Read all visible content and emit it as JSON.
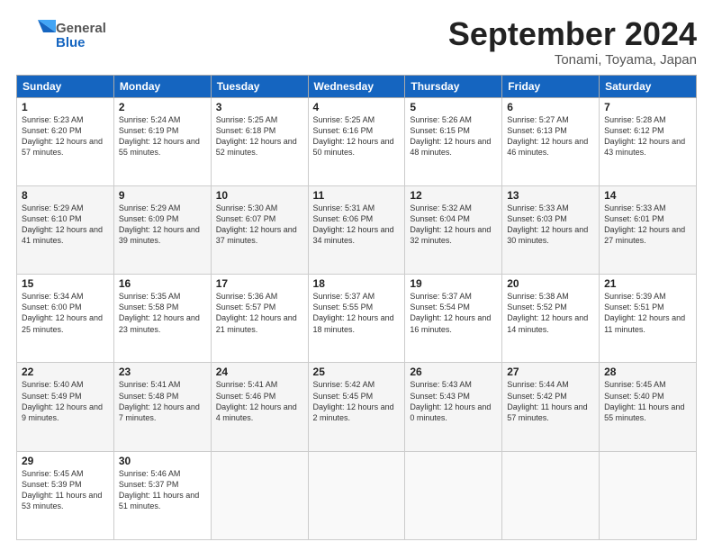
{
  "header": {
    "logo_general": "General",
    "logo_blue": "Blue",
    "month": "September 2024",
    "location": "Tonami, Toyama, Japan"
  },
  "days_of_week": [
    "Sunday",
    "Monday",
    "Tuesday",
    "Wednesday",
    "Thursday",
    "Friday",
    "Saturday"
  ],
  "weeks": [
    [
      {
        "day": "1",
        "sunrise": "5:23 AM",
        "sunset": "6:20 PM",
        "daylight": "12 hours and 57 minutes."
      },
      {
        "day": "2",
        "sunrise": "5:24 AM",
        "sunset": "6:19 PM",
        "daylight": "12 hours and 55 minutes."
      },
      {
        "day": "3",
        "sunrise": "5:25 AM",
        "sunset": "6:18 PM",
        "daylight": "12 hours and 52 minutes."
      },
      {
        "day": "4",
        "sunrise": "5:25 AM",
        "sunset": "6:16 PM",
        "daylight": "12 hours and 50 minutes."
      },
      {
        "day": "5",
        "sunrise": "5:26 AM",
        "sunset": "6:15 PM",
        "daylight": "12 hours and 48 minutes."
      },
      {
        "day": "6",
        "sunrise": "5:27 AM",
        "sunset": "6:13 PM",
        "daylight": "12 hours and 46 minutes."
      },
      {
        "day": "7",
        "sunrise": "5:28 AM",
        "sunset": "6:12 PM",
        "daylight": "12 hours and 43 minutes."
      }
    ],
    [
      {
        "day": "8",
        "sunrise": "5:29 AM",
        "sunset": "6:10 PM",
        "daylight": "12 hours and 41 minutes."
      },
      {
        "day": "9",
        "sunrise": "5:29 AM",
        "sunset": "6:09 PM",
        "daylight": "12 hours and 39 minutes."
      },
      {
        "day": "10",
        "sunrise": "5:30 AM",
        "sunset": "6:07 PM",
        "daylight": "12 hours and 37 minutes."
      },
      {
        "day": "11",
        "sunrise": "5:31 AM",
        "sunset": "6:06 PM",
        "daylight": "12 hours and 34 minutes."
      },
      {
        "day": "12",
        "sunrise": "5:32 AM",
        "sunset": "6:04 PM",
        "daylight": "12 hours and 32 minutes."
      },
      {
        "day": "13",
        "sunrise": "5:33 AM",
        "sunset": "6:03 PM",
        "daylight": "12 hours and 30 minutes."
      },
      {
        "day": "14",
        "sunrise": "5:33 AM",
        "sunset": "6:01 PM",
        "daylight": "12 hours and 27 minutes."
      }
    ],
    [
      {
        "day": "15",
        "sunrise": "5:34 AM",
        "sunset": "6:00 PM",
        "daylight": "12 hours and 25 minutes."
      },
      {
        "day": "16",
        "sunrise": "5:35 AM",
        "sunset": "5:58 PM",
        "daylight": "12 hours and 23 minutes."
      },
      {
        "day": "17",
        "sunrise": "5:36 AM",
        "sunset": "5:57 PM",
        "daylight": "12 hours and 21 minutes."
      },
      {
        "day": "18",
        "sunrise": "5:37 AM",
        "sunset": "5:55 PM",
        "daylight": "12 hours and 18 minutes."
      },
      {
        "day": "19",
        "sunrise": "5:37 AM",
        "sunset": "5:54 PM",
        "daylight": "12 hours and 16 minutes."
      },
      {
        "day": "20",
        "sunrise": "5:38 AM",
        "sunset": "5:52 PM",
        "daylight": "12 hours and 14 minutes."
      },
      {
        "day": "21",
        "sunrise": "5:39 AM",
        "sunset": "5:51 PM",
        "daylight": "12 hours and 11 minutes."
      }
    ],
    [
      {
        "day": "22",
        "sunrise": "5:40 AM",
        "sunset": "5:49 PM",
        "daylight": "12 hours and 9 minutes."
      },
      {
        "day": "23",
        "sunrise": "5:41 AM",
        "sunset": "5:48 PM",
        "daylight": "12 hours and 7 minutes."
      },
      {
        "day": "24",
        "sunrise": "5:41 AM",
        "sunset": "5:46 PM",
        "daylight": "12 hours and 4 minutes."
      },
      {
        "day": "25",
        "sunrise": "5:42 AM",
        "sunset": "5:45 PM",
        "daylight": "12 hours and 2 minutes."
      },
      {
        "day": "26",
        "sunrise": "5:43 AM",
        "sunset": "5:43 PM",
        "daylight": "12 hours and 0 minutes."
      },
      {
        "day": "27",
        "sunrise": "5:44 AM",
        "sunset": "5:42 PM",
        "daylight": "11 hours and 57 minutes."
      },
      {
        "day": "28",
        "sunrise": "5:45 AM",
        "sunset": "5:40 PM",
        "daylight": "11 hours and 55 minutes."
      }
    ],
    [
      {
        "day": "29",
        "sunrise": "5:45 AM",
        "sunset": "5:39 PM",
        "daylight": "11 hours and 53 minutes."
      },
      {
        "day": "30",
        "sunrise": "5:46 AM",
        "sunset": "5:37 PM",
        "daylight": "11 hours and 51 minutes."
      },
      null,
      null,
      null,
      null,
      null
    ]
  ]
}
